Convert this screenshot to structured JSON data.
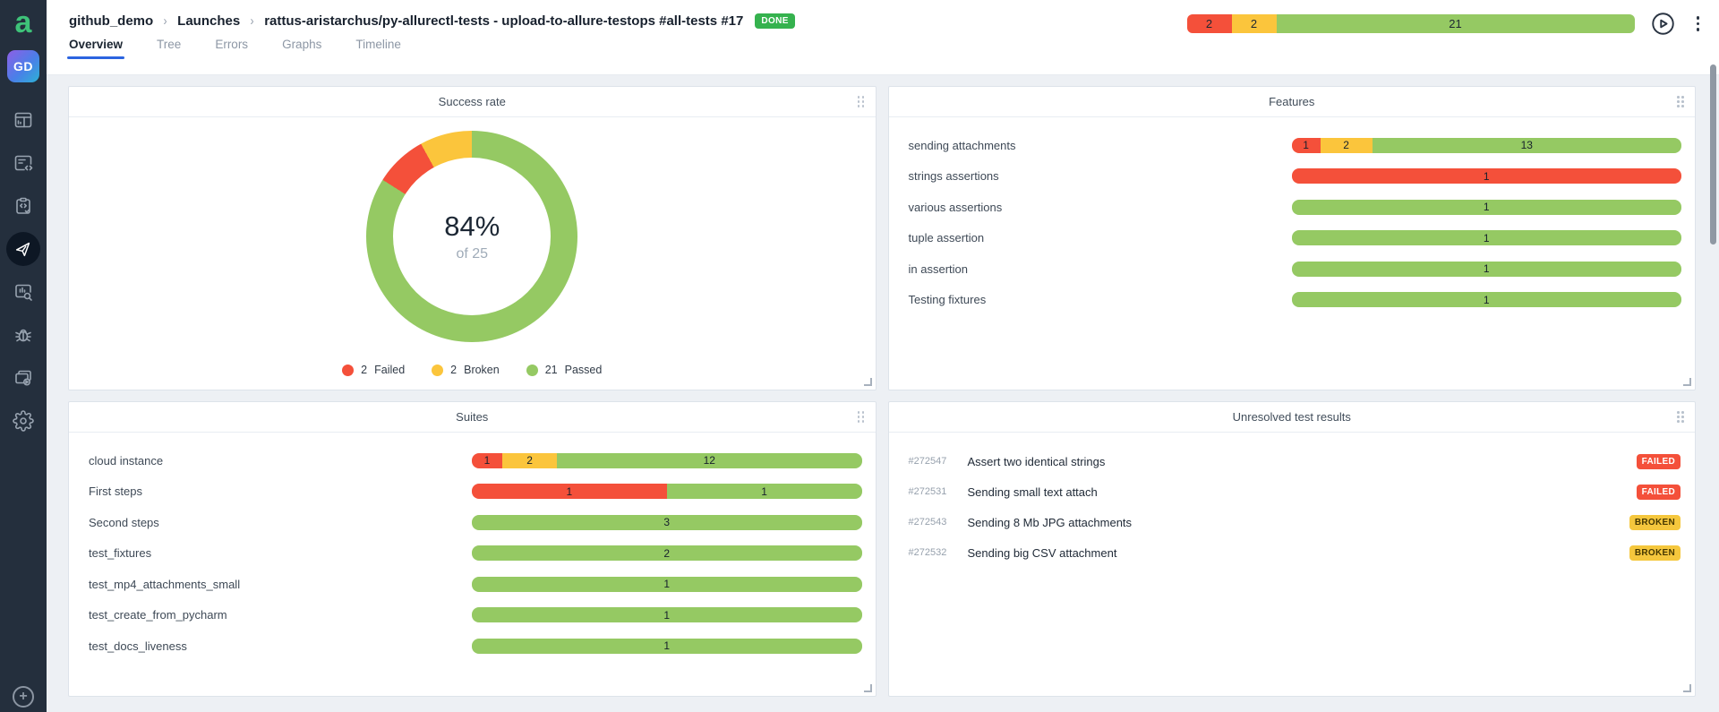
{
  "app": {
    "logo_letter": "a"
  },
  "sidebar": {
    "avatar": "GD",
    "plus": "+"
  },
  "header": {
    "breadcrumb": [
      "github_demo",
      "Launches",
      "rattus-aristarchus/py-allurectl-tests - upload-to-allure-testops #all-tests #17"
    ],
    "separator": "›",
    "status_badge": "DONE",
    "status_bar": {
      "segments": [
        {
          "status": "failed",
          "value": 2
        },
        {
          "status": "broken",
          "value": 2
        },
        {
          "status": "passed",
          "value": 21
        }
      ]
    },
    "tabs": [
      {
        "label": "Overview",
        "active": true
      },
      {
        "label": "Tree",
        "active": false
      },
      {
        "label": "Errors",
        "active": false
      },
      {
        "label": "Graphs",
        "active": false
      },
      {
        "label": "Timeline",
        "active": false
      }
    ]
  },
  "colors": {
    "failed": "#f4503a",
    "broken": "#fbc53c",
    "passed": "#95c963",
    "accent": "#2b64e0",
    "done": "#35b24e"
  },
  "panels": {
    "success_rate": {
      "title": "Success rate",
      "percent": "84%",
      "of": "of 25",
      "segments": [
        {
          "status": "passed",
          "value": 21
        },
        {
          "status": "failed",
          "value": 2
        },
        {
          "status": "broken",
          "value": 2
        }
      ],
      "legend": [
        {
          "status": "failed",
          "value": "2",
          "label": "Failed"
        },
        {
          "status": "broken",
          "value": "2",
          "label": "Broken"
        },
        {
          "status": "passed",
          "value": "21",
          "label": "Passed"
        }
      ]
    },
    "features": {
      "title": "Features",
      "rows": [
        {
          "label": "sending attachments",
          "segments": [
            {
              "status": "failed",
              "value": 1
            },
            {
              "status": "broken",
              "value": 2
            },
            {
              "status": "passed",
              "value": 13
            }
          ]
        },
        {
          "label": "strings assertions",
          "segments": [
            {
              "status": "failed",
              "value": 1
            }
          ]
        },
        {
          "label": "various assertions",
          "segments": [
            {
              "status": "passed",
              "value": 1
            }
          ]
        },
        {
          "label": "tuple assertion",
          "segments": [
            {
              "status": "passed",
              "value": 1
            }
          ]
        },
        {
          "label": "in assertion",
          "segments": [
            {
              "status": "passed",
              "value": 1
            }
          ]
        },
        {
          "label": "Testing fixtures",
          "segments": [
            {
              "status": "passed",
              "value": 1
            }
          ]
        }
      ]
    },
    "suites": {
      "title": "Suites",
      "rows": [
        {
          "label": "cloud instance",
          "segments": [
            {
              "status": "failed",
              "value": 1
            },
            {
              "status": "broken",
              "value": 2
            },
            {
              "status": "passed",
              "value": 12
            }
          ]
        },
        {
          "label": "First steps",
          "segments": [
            {
              "status": "failed",
              "value": 1
            },
            {
              "status": "passed",
              "value": 1
            }
          ]
        },
        {
          "label": "Second steps",
          "segments": [
            {
              "status": "passed",
              "value": 3
            }
          ]
        },
        {
          "label": "test_fixtures",
          "segments": [
            {
              "status": "passed",
              "value": 2
            }
          ]
        },
        {
          "label": "test_mp4_attachments_small",
          "segments": [
            {
              "status": "passed",
              "value": 1
            }
          ]
        },
        {
          "label": "test_create_from_pycharm",
          "segments": [
            {
              "status": "passed",
              "value": 1
            }
          ]
        },
        {
          "label": "test_docs_liveness",
          "segments": [
            {
              "status": "passed",
              "value": 1
            }
          ]
        }
      ]
    },
    "unresolved": {
      "title": "Unresolved test results",
      "rows": [
        {
          "id": "#272547",
          "name": "Assert two identical strings",
          "badge": "FAILED",
          "status": "failed"
        },
        {
          "id": "#272531",
          "name": "Sending small text attach",
          "badge": "FAILED",
          "status": "failed"
        },
        {
          "id": "#272543",
          "name": "Sending 8 Mb JPG attachments",
          "badge": "BROKEN",
          "status": "broken"
        },
        {
          "id": "#272532",
          "name": "Sending big CSV attachment",
          "badge": "BROKEN",
          "status": "broken"
        }
      ]
    }
  }
}
